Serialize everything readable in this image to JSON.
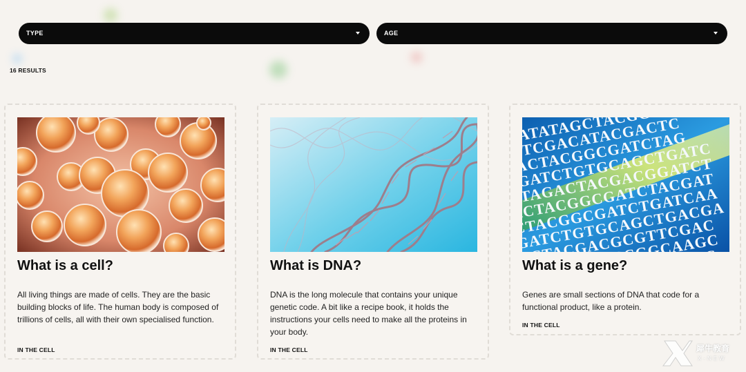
{
  "filters": {
    "type_label": "TYPE",
    "age_label": "AGE"
  },
  "results_count": "16 RESULTS",
  "cards": [
    {
      "title": "What is a cell?",
      "description": "All living things are made of cells. They are the basic building blocks of life. The human body is composed of trillions of cells, all with their own specialised function.",
      "tag": "IN THE CELL"
    },
    {
      "title": "What is DNA?",
      "description": "DNA is the long molecule that contains your unique genetic code. A bit like a recipe book, it holds the instructions your cells need to make all the proteins in your body.",
      "tag": "IN THE CELL"
    },
    {
      "title": "What is a gene?",
      "description": "Genes are small sections of DNA that code for a functional product, like a protein.",
      "tag": "IN THE CELL",
      "image_sequence_lines": [
        "ATATATAGCTACGGCA",
        "ATTCGACATACGACTC",
        "GACTACGGCGATCTAG",
        "AGATCTGTGCAGCTGATC",
        "CTAGACTACGACGGATCT",
        "ACTACGGCGATCTACGAT",
        "CTACGGCGATCTGATCAA",
        "GATCTGTGCAGCTGACGA",
        "ACTACGACGCGTTCGAC",
        "GATCTACGGCGGCAAGC",
        "AGACTACGGATCTAGTC",
        "CTAGCGAATCGATCTC"
      ]
    }
  ],
  "logo": {
    "text": "犀牛教育",
    "subtext": "X-NEW"
  }
}
